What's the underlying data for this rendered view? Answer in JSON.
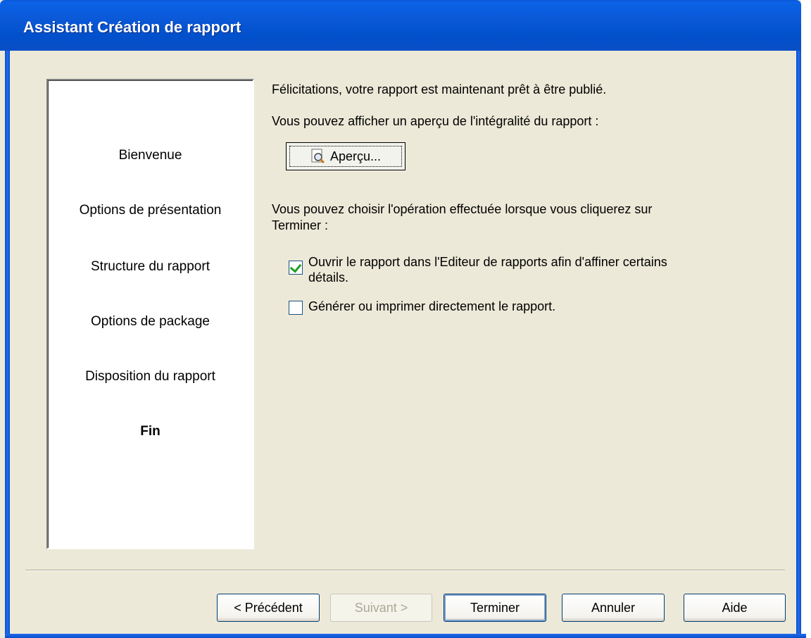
{
  "window": {
    "title": "Assistant Création de rapport"
  },
  "steps": [
    {
      "label": "Bienvenue",
      "active": false
    },
    {
      "label": "Options de présentation",
      "active": false
    },
    {
      "label": "Structure du rapport",
      "active": false
    },
    {
      "label": "Options de package",
      "active": false
    },
    {
      "label": "Disposition du rapport",
      "active": false
    },
    {
      "label": "Fin",
      "active": true
    }
  ],
  "content": {
    "congrats": "Félicitations, votre rapport est maintenant prêt à être publié.",
    "preview_intro": "Vous pouvez afficher un aperçu de l'intégralité du rapport :",
    "preview_button": "Aperçu...",
    "finish_intro_line1": "Vous pouvez choisir l'opération effectuée lorsque vous cliquerez sur",
    "finish_intro_line2": "Terminer :",
    "option_open_line1": "Ouvrir le rapport dans l'Editeur de rapports afin d'affiner certains",
    "option_open_line2": "détails.",
    "option_open_checked": true,
    "option_generate": "Générer ou imprimer directement le rapport.",
    "option_generate_checked": false
  },
  "buttons": {
    "previous": "< Précédent",
    "next": "Suivant >",
    "finish": "Terminer",
    "cancel": "Annuler",
    "help": "Aide"
  },
  "colors": {
    "titlebar": "#0a58d6",
    "dialog_bg": "#ece9d8",
    "check": "#21a121"
  }
}
